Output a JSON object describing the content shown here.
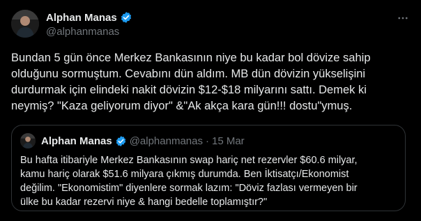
{
  "colors": {
    "background": "#000000",
    "text_primary": "#e7e9ea",
    "text_secondary": "#71767b",
    "verified_badge": "#1d9bf0",
    "border": "#2f3336"
  },
  "tweet": {
    "author": {
      "display_name": "Alphan Manas",
      "handle": "@alphanmanas",
      "verified_icon": "verified-badge-icon",
      "avatar_icon": "avatar"
    },
    "more_icon": "more-options-icon",
    "text": "Bundan 5 gün önce Merkez Bankasının niye bu kadar bol dövize sahip\nolduğunu sormuştum. Cevabını dün aldım. MB dün dövizin yükselişini\ndurdurmak için elindeki nakit dövizin $12-$18 milyarını sattı. Demek ki\nneymiş? \"Kaza geliyorum diyor\" &\"Ak akça kara gün!!! dostu\"ymuş.",
    "quote": {
      "display_name": "Alphan Manas",
      "handle": "@alphanmanas",
      "separator": "·",
      "date": "15 Mar",
      "text": "Bu hafta itibariyle Merkez Bankasının swap hariç net rezervler $60.6 milyar,\nkamu hariç olarak $51.6 milyara çıkmış durumda. Ben İktisatçı/Ekonomist\ndeğilim. \"Ekonomistim\" diyenlere sormak lazım: \"Döviz fazlası vermeyen bir\nülke bu kadar rezervi niye & hangi bedelle toplamıştır?\""
    }
  }
}
